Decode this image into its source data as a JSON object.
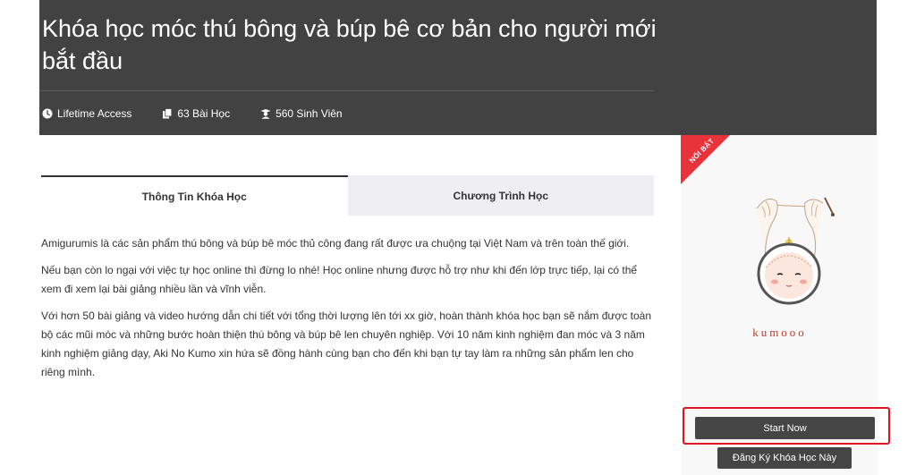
{
  "course": {
    "title": "Khóa học móc thú bông và búp bê cơ bản cho người mới bắt đầu",
    "meta": [
      {
        "icon": "clock-icon",
        "label": "Lifetime Access"
      },
      {
        "icon": "copy-icon",
        "label": "63 Bài Học"
      },
      {
        "icon": "graduate-icon",
        "label": "560 Sinh Viên"
      }
    ]
  },
  "tabs": [
    {
      "label": "Thông Tin Khóa Học",
      "active": true
    },
    {
      "label": "Chương Trình Học",
      "active": false
    }
  ],
  "content": {
    "paragraphs": [
      "Amigurumis là các sản phẩm thú bông và búp bê móc thủ công đang rất được ưa chuộng tại Việt Nam và trên toàn thế giới.",
      "Nếu bạn còn lo ngại với việc tự học online thì đừng lo nhé! Học online nhưng được hỗ trợ như khi đến lớp trực tiếp, lại có thể xem đi xem lại bài giảng nhiều lần và vĩnh viễn.",
      "Với hơn 50 bài giảng và video hướng dẫn chi tiết với tổng thời lượng lên tới xx giờ, hoàn thành khóa học bạn sẽ nắm được toàn bộ các mũi móc và những bước hoàn thiện thú bông và búp bê len chuyên nghiệp. Với 10 năm kinh nghiệm đan móc và 3 năm kinh nghiệm giảng dạy, Aki No Kumo xin hứa sẽ đồng hành cùng bạn cho đến khi bạn tự tay làm ra những sản phẩm len cho riêng mình."
    ]
  },
  "sidebar": {
    "ribbon": "NỔI BẬT",
    "brand": "kumooo",
    "start_label": "Start Now",
    "register_label": "Đăng Ký Khóa Học Này",
    "accent_color": "#e8333a"
  }
}
